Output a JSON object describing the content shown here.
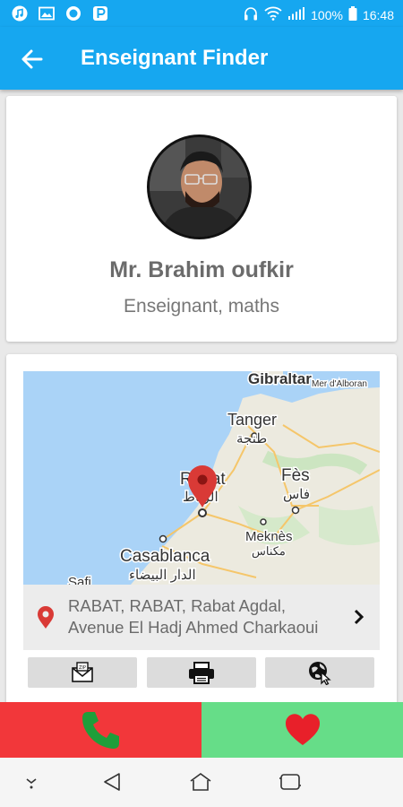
{
  "status_bar": {
    "battery": "100%",
    "time": "16:48",
    "left_icons": [
      "music-icon",
      "image-icon",
      "circle-app-icon",
      "p-app-icon"
    ],
    "right_icons": [
      "headphones-icon",
      "wifi-icon",
      "signal-icon",
      "battery-icon"
    ]
  },
  "app_bar": {
    "title": "Enseignant Finder",
    "back_icon": "back-arrow-icon"
  },
  "profile": {
    "name": "Mr. Brahim oufkir",
    "subtitle": "Enseignant, maths"
  },
  "map": {
    "labels": {
      "gibraltar": "Gibraltar",
      "sea": "Mer d'Alboran",
      "tanger": "Tanger",
      "tanger_ar": "طنجة",
      "fes": "Fès",
      "fes_ar": "فاس",
      "rabat": "Rabat",
      "rabat_ar": "الرباط",
      "meknes": "Meknès",
      "meknes_ar": "مكناس",
      "casablanca": "Casablanca",
      "casablanca_ar": "الدار البيضاء",
      "safi": "Safi"
    }
  },
  "address": {
    "line1": "RABAT, RABAT, Rabat Agdal,",
    "line2": "Avenue El Hadj Ahmed Charkaoui"
  },
  "actions": [
    "email-zip-icon",
    "print-icon",
    "globe-cursor-icon"
  ],
  "bottom_actions": {
    "call_icon": "phone-icon",
    "favorite_icon": "heart-icon"
  },
  "colors": {
    "primary": "#16a7f0",
    "call": "#f2373a",
    "favorite": "#66dd88",
    "heart": "#e8202a",
    "phone": "#1f9e3a",
    "pin": "#d93a36"
  }
}
